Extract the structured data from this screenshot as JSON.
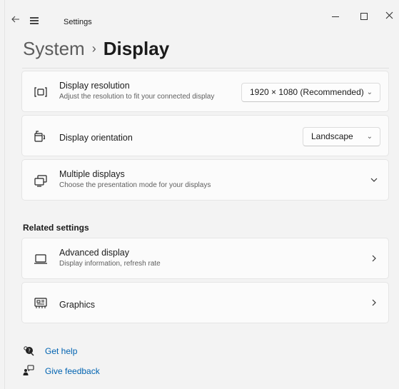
{
  "titlebar": {
    "app_title": "Settings",
    "back_icon": "arrow-left-icon",
    "menu_icon": "hamburger-icon",
    "controls": {
      "minimize": "minimize-icon",
      "maximize": "maximize-icon",
      "close": "close-icon"
    }
  },
  "breadcrumb": {
    "parent": "System",
    "separator": "›",
    "current": "Display"
  },
  "cards": {
    "resolution": {
      "icon": "resolution-icon",
      "title": "Display resolution",
      "subtitle": "Adjust the resolution to fit your connected display",
      "value": "1920 × 1080 (Recommended)"
    },
    "orientation": {
      "icon": "orientation-icon",
      "title": "Display orientation",
      "value": "Landscape"
    },
    "multiple": {
      "icon": "multiple-displays-icon",
      "title": "Multiple displays",
      "subtitle": "Choose the presentation mode for your displays"
    }
  },
  "related": {
    "heading": "Related settings",
    "items": [
      {
        "icon": "monitor-icon",
        "title": "Advanced display",
        "subtitle": "Display information, refresh rate"
      },
      {
        "icon": "graphics-icon",
        "title": "Graphics"
      }
    ]
  },
  "footer_links": {
    "help": {
      "icon": "help-icon",
      "label": "Get help"
    },
    "feedback": {
      "icon": "feedback-icon",
      "label": "Give feedback"
    }
  },
  "colors": {
    "accent": "#0063b1",
    "background": "#f3f3f3",
    "card": "#fbfbfb"
  }
}
